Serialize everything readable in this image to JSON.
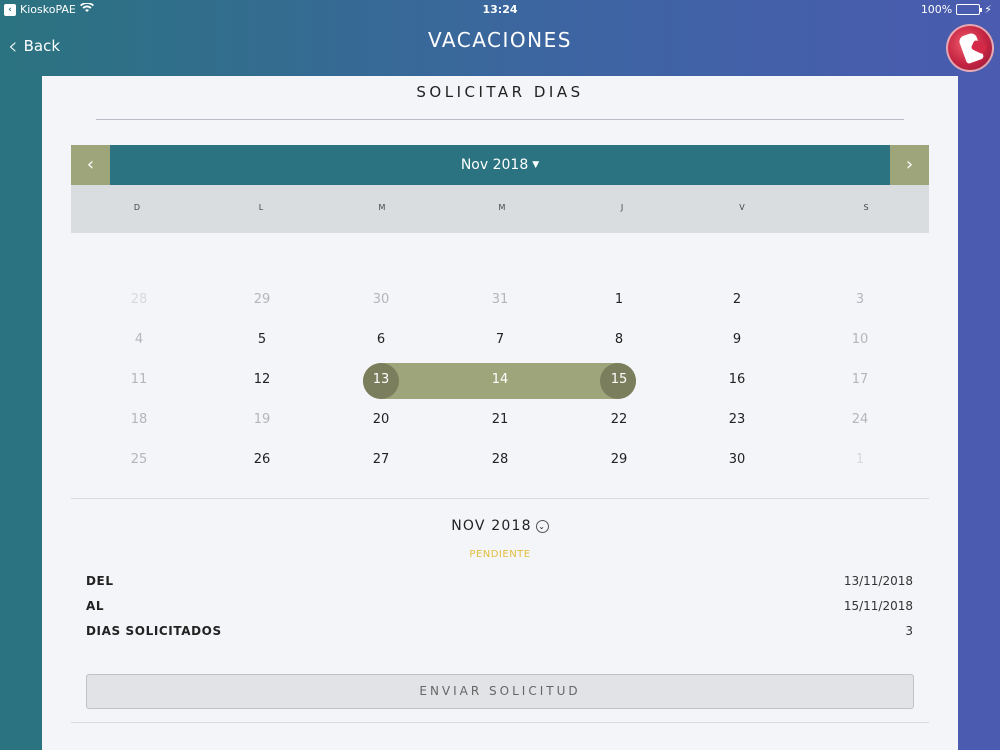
{
  "status_bar": {
    "back_app_label": "KioskoPAE",
    "time": "13:24",
    "battery": "100%",
    "battery_level": 1.0
  },
  "nav": {
    "back_label": "Back",
    "title": "VACACIONES"
  },
  "card": {
    "title": "SOLICITAR DIAS"
  },
  "calendar": {
    "month_label": "Nov 2018",
    "prev_icon": "chevron-left-icon",
    "next_icon": "chevron-right-icon",
    "weekdays": [
      "D",
      "L",
      "M",
      "M",
      "J",
      "V",
      "S"
    ],
    "weeks": [
      [
        "28",
        "29",
        "30",
        "31",
        "1",
        "2",
        "3"
      ],
      [
        "4",
        "5",
        "6",
        "7",
        "8",
        "9",
        "10"
      ],
      [
        "11",
        "12",
        "13",
        "14",
        "15",
        "16",
        "17"
      ],
      [
        "18",
        "19",
        "20",
        "21",
        "22",
        "23",
        "24"
      ],
      [
        "25",
        "26",
        "27",
        "28",
        "29",
        "30",
        "1"
      ]
    ],
    "selected_range": [
      "13",
      "14",
      "15"
    ]
  },
  "summary": {
    "month_label": "NOV 2018",
    "status": "PENDIENTE",
    "rows": [
      {
        "label": "DEL",
        "value": "13/11/2018"
      },
      {
        "label": "AL",
        "value": "15/11/2018"
      },
      {
        "label": "DIAS SOLICITADOS",
        "value": "3"
      }
    ],
    "send_label": "ENVIAR SOLICITUD"
  },
  "colors": {
    "teal": "#2b7380",
    "olive": "#9ea57a",
    "olive_dark": "#7b7e5c",
    "status_pending": "#e2be3b"
  }
}
